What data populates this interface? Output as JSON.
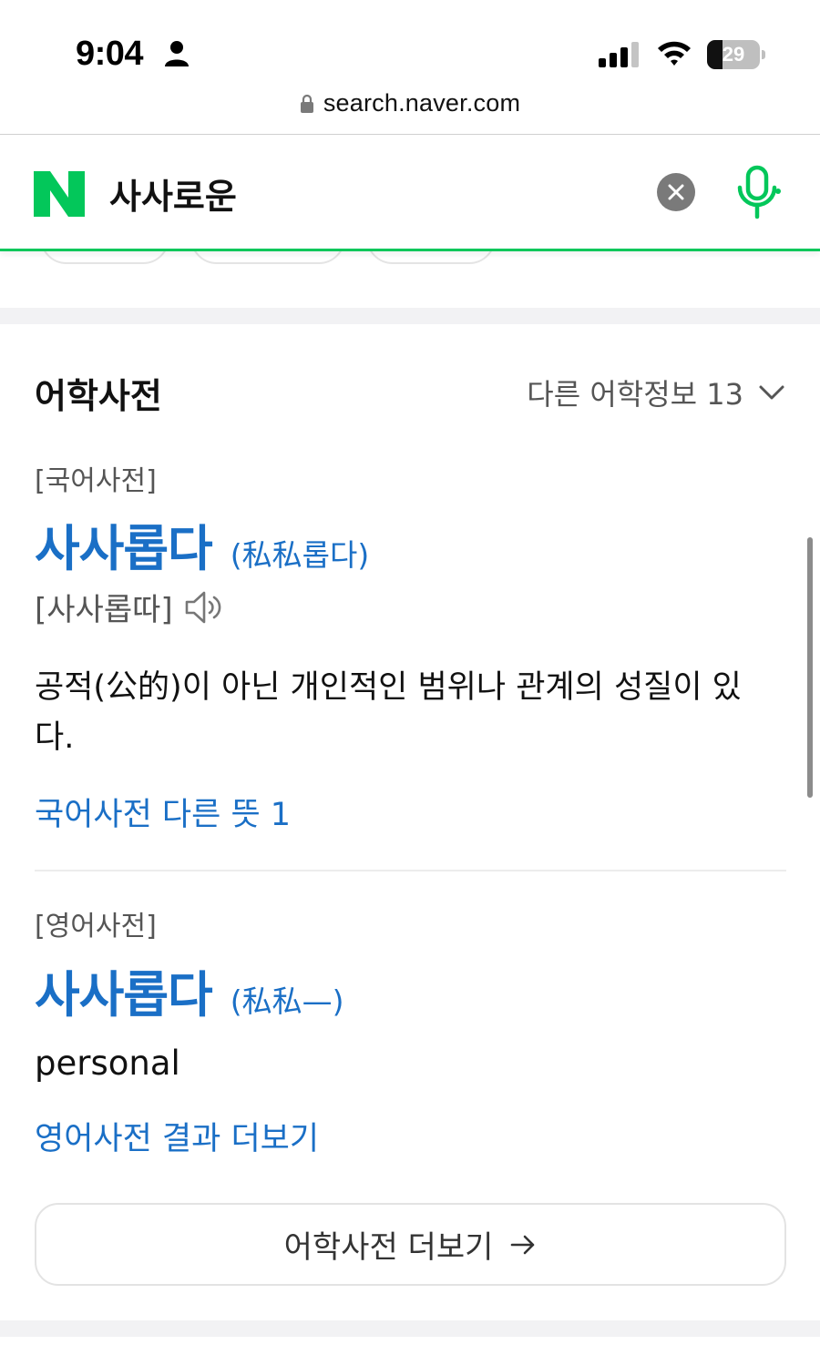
{
  "status_bar": {
    "time": "9:04",
    "battery_level": "29",
    "battery_percent": 29
  },
  "url_bar": {
    "url": "search.naver.com"
  },
  "search": {
    "logo": "N",
    "query": "사사로운",
    "brand_color": "#03c75a"
  },
  "dictionary": {
    "title": "어학사전",
    "more_info_label": "다른 어학정보 13",
    "korean": {
      "tag": "[국어사전]",
      "headword": "사사롭다",
      "hanja": "(私私롭다)",
      "pronunciation": "[사사롭따]",
      "definition": "공적(公的)이 아닌 개인적인 범위나 관계의 성질이 있다.",
      "other_meanings_link": "국어사전 다른 뜻 1"
    },
    "english": {
      "tag": "[영어사전]",
      "headword": "사사롭다",
      "hanja": "(私私—)",
      "translation": "personal",
      "more_link": "영어사전 결과 더보기"
    },
    "more_button_label": "어학사전 더보기",
    "link_color": "#1a6fc6"
  }
}
